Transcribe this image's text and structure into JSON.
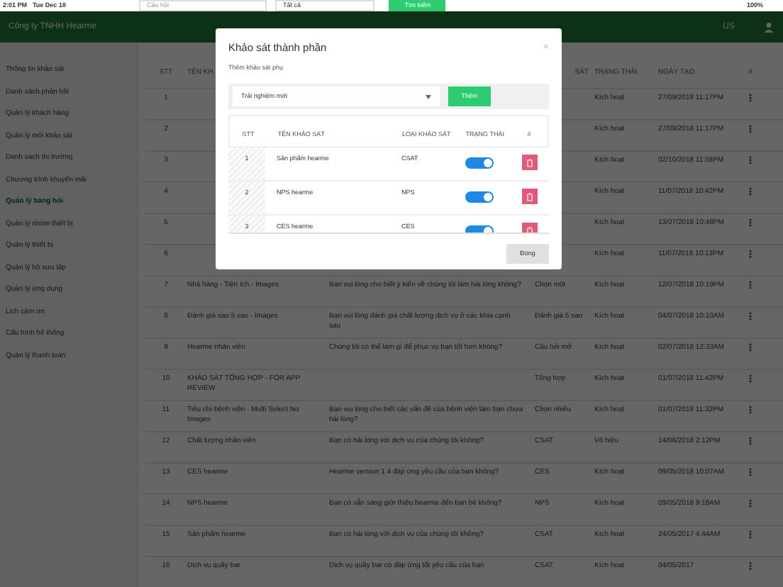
{
  "status_bar": {
    "time": "2:01 PM",
    "date": "Tue Dec 18",
    "battery": "100%"
  },
  "search": {
    "question_placeholder": "Câu hỏi",
    "filter_value": "Tất cả",
    "button": "Tìm kiếm"
  },
  "header": {
    "company": "Công ty TNHH Hearme",
    "language": "US"
  },
  "sidebar": {
    "items": [
      {
        "label": "Thông tin khảo sát",
        "selected": false
      },
      {
        "label": "Danh sách phản hồi",
        "selected": false
      },
      {
        "label": "Quản lý khách hàng",
        "selected": false
      },
      {
        "label": "Quản lý môi khảo sát",
        "selected": false
      },
      {
        "label": "Danh sách thị trường",
        "selected": false
      },
      {
        "label": "Chương trình khuyến mãi",
        "selected": false
      },
      {
        "label": "Quản lý bảng hỏi",
        "selected": true
      },
      {
        "label": "Quản lý nhóm thiết bị",
        "selected": false
      },
      {
        "label": "Quản lý thiết bị",
        "selected": false
      },
      {
        "label": "Quản lý bộ sưu tập",
        "selected": false
      },
      {
        "label": "Quản lý ứng dụng",
        "selected": false
      },
      {
        "label": "Lịch cảm ơn",
        "selected": false
      },
      {
        "label": "Cấu hình hệ thống",
        "selected": false
      },
      {
        "label": "Quản lý thanh toán",
        "selected": false
      }
    ]
  },
  "table": {
    "columns": [
      {
        "kind": "stt",
        "label": "STT"
      },
      {
        "kind": "name",
        "label": "TÊN KH"
      },
      {
        "kind": "type",
        "label": "SÁT"
      },
      {
        "kind": "status",
        "label": "TRẠNG THÁI"
      },
      {
        "kind": "date",
        "label": "NGÀY TẠO"
      },
      {
        "kind": "actions",
        "label": "#"
      }
    ],
    "rows": [
      {
        "stt": "1",
        "status": "Kích hoạt",
        "date": "27/09/2018 11:17PM"
      },
      {
        "stt": "2",
        "status": "Kích hoạt",
        "date": "27/09/2018 11:17PM"
      },
      {
        "stt": "3",
        "status": "Kích hoạt",
        "date": "02/10/2018 11:58PM"
      },
      {
        "stt": "4",
        "status": "Kích hoạt",
        "date": "11/07/2018 10:42PM"
      },
      {
        "stt": "5",
        "status": "Kích hoạt",
        "date": "13/07/2018 10:48PM"
      },
      {
        "stt": "6",
        "status": "Kích hoạt",
        "date": "11/07/2018 10:13PM"
      },
      {
        "stt": "7",
        "name": "Nhà hàng - Tiện ích - Images",
        "question": "Bạn vui lòng cho biết ý kiến về chúng tôi làm hài lòng không?",
        "type": "Chọn một",
        "status": "Kích hoạt",
        "date": "12/07/2018 10:19PM"
      },
      {
        "stt": "8",
        "name": "Đánh giá sao 5 sao - Images",
        "question": "Bạn vui lòng đánh giá chất lượng dịch vụ ở các khía cạnh sau",
        "type": "Đánh giá 5 sao",
        "status": "Kích hoạt",
        "date": "04/07/2018 10:10AM"
      },
      {
        "stt": "9",
        "name": "Hearme nhân viên",
        "question": "Chúng tôi có thể làm gì để phục vụ bạn tốt hơn không?",
        "type": "Câu hỏi mở",
        "status": "Kích hoạt",
        "date": "02/07/2018 12:33AM"
      },
      {
        "stt": "10",
        "name": "KHẢO SÁT TỔNG HỢP - FOR APP REVIEW",
        "type": "Tổng hợp",
        "status": "Kích hoạt",
        "date": "01/07/2018 11:42PM"
      },
      {
        "stt": "11",
        "name": "Tiêu chí bệnh viện - Multi Select No Images",
        "question": "Bạn vui lòng cho biết các vấn đề của bệnh viện làm bạn chưa hài lòng?",
        "type": "Chọn nhiều",
        "status": "Kích hoạt",
        "date": "01/07/2018 11:32PM"
      },
      {
        "stt": "12",
        "name": "Chất lượng nhân viên",
        "question": "Bạn có hài lòng với dịch vụ của chúng tôi không?",
        "type": "CSAT",
        "status": "Vô hiệu",
        "date": "14/06/2018 2:12PM"
      },
      {
        "stt": "13",
        "name": "CES hearme",
        "question": "Hearme version 1.4 đáp ứng yêu cầu của bạn không?",
        "type": "CES",
        "status": "Kích hoạt",
        "date": "09/05/2018 10:07AM"
      },
      {
        "stt": "14",
        "name": "NPS hearme",
        "question": "Bạn có sẵn sàng giới thiệu hearme đến bạn bè không?",
        "type": "NPS",
        "status": "Kích hoạt",
        "date": "09/05/2018 9:18AM"
      },
      {
        "stt": "15",
        "name": "Sản phẩm hearme",
        "question": "Bạn có hài lòng với dịch vụ của chúng tôi không?",
        "type": "CSAT",
        "status": "Kích hoạt",
        "date": "24/05/2017 4:44AM"
      },
      {
        "stt": "16",
        "name": "Dịch vụ quầy bar",
        "question": "Dịch vụ quầy bar có đáp ứng tốt yêu cầu của bạn",
        "type": "CSAT",
        "status": "Kích hoạt",
        "date": "04/05/2017"
      }
    ]
  },
  "modal": {
    "title": "Khảo sát thành phần",
    "close": "×",
    "subtitle": "Thêm khảo sát phụ",
    "select_value": "Trải nghiệm mới",
    "add_button": "Thêm",
    "columns": [
      "STT",
      "TÊN KHẢO SÁT",
      "LOẠI KHẢO SÁT",
      "TRẠNG THÁI",
      "#"
    ],
    "rows": [
      {
        "stt": "1",
        "name": "Sản phẩm hearme",
        "type": "CSAT",
        "on": true
      },
      {
        "stt": "2",
        "name": "NPS hearme",
        "type": "NPS",
        "on": true
      },
      {
        "stt": "3",
        "name": "CES hearme",
        "type": "CES",
        "on": true
      }
    ],
    "close_button": "Đóng"
  }
}
